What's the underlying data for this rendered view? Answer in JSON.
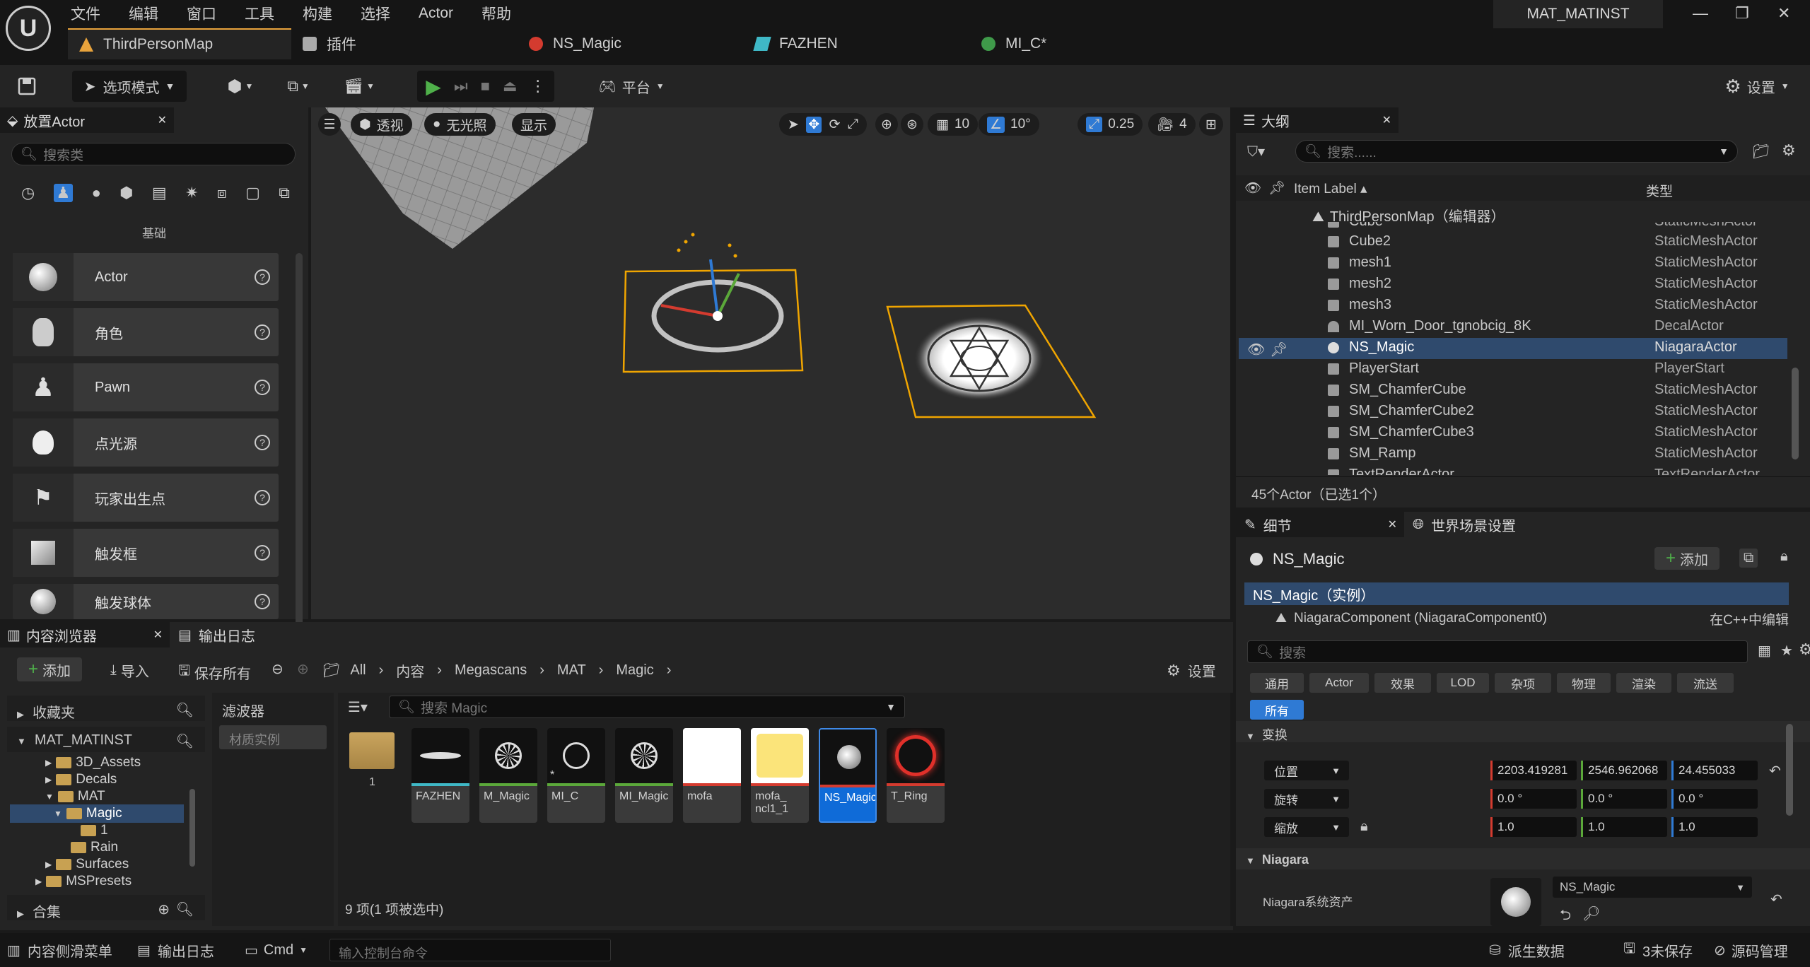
{
  "menu": [
    "文件",
    "编辑",
    "窗口",
    "工具",
    "构建",
    "选择",
    "Actor",
    "帮助"
  ],
  "project_name": "MAT_MATINST",
  "tabs": [
    {
      "label": "ThirdPersonMap",
      "color": "#e8a33c"
    },
    {
      "label": "插件",
      "color": "#bbbbbb"
    },
    {
      "label": "NS_Magic",
      "color": "#d43b2f"
    },
    {
      "label": "FAZHEN",
      "color": "#3fb8c6"
    },
    {
      "label": "MI_C*",
      "color": "#3f9a4a"
    }
  ],
  "toolbar": {
    "mode": "选项模式",
    "platform": "平台",
    "settings": "设置"
  },
  "place_actor": {
    "title": "放置Actor",
    "search_placeholder": "搜索类",
    "category": "基础",
    "items": [
      "Actor",
      "角色",
      "Pawn",
      "点光源",
      "玩家出生点",
      "触发框",
      "触发球体"
    ]
  },
  "viewport": {
    "perspective": "透视",
    "lighting": "无光照",
    "show": "显示",
    "grid": "10",
    "angle": "10°",
    "scale": "0.25",
    "camera": "4"
  },
  "outliner": {
    "title": "大纲",
    "search_placeholder": "搜索......",
    "col_label": "Item Label",
    "col_type": "类型",
    "map": "ThirdPersonMap（编辑器）",
    "rows": [
      {
        "name": "Cube",
        "type": "StaticMeshActor"
      },
      {
        "name": "Cube2",
        "type": "StaticMeshActor"
      },
      {
        "name": "mesh1",
        "type": "StaticMeshActor"
      },
      {
        "name": "mesh2",
        "type": "StaticMeshActor"
      },
      {
        "name": "mesh3",
        "type": "StaticMeshActor"
      },
      {
        "name": "MI_Worn_Door_tgnobcig_8K",
        "type": "DecalActor"
      },
      {
        "name": "NS_Magic",
        "type": "NiagaraActor"
      },
      {
        "name": "PlayerStart",
        "type": "PlayerStart"
      },
      {
        "name": "SM_ChamferCube",
        "type": "StaticMeshActor"
      },
      {
        "name": "SM_ChamferCube2",
        "type": "StaticMeshActor"
      },
      {
        "name": "SM_ChamferCube3",
        "type": "StaticMeshActor"
      },
      {
        "name": "SM_Ramp",
        "type": "StaticMeshActor"
      },
      {
        "name": "TextRenderActor",
        "type": "TextRenderActor"
      }
    ],
    "footer": "45个Actor（已选1个）"
  },
  "details": {
    "title": "细节",
    "world_settings": "世界场景设置",
    "object": "NS_Magic",
    "add": "添加",
    "instance": "NS_Magic（实例）",
    "component": "NiagaraComponent (NiagaraComponent0)",
    "edit_cpp": "在C++中编辑",
    "search_placeholder": "搜索",
    "categories": [
      "通用",
      "Actor",
      "效果",
      "LOD",
      "杂项",
      "物理",
      "渲染",
      "流送"
    ],
    "all": "所有",
    "transform": "变换",
    "location_label": "位置",
    "rotation_label": "旋转",
    "scale_label": "缩放",
    "location": [
      "2203.419281",
      "2546.962068",
      "24.455033"
    ],
    "rotation": [
      "0.0 °",
      "0.0 °",
      "0.0 °"
    ],
    "scale": [
      "1.0",
      "1.0",
      "1.0"
    ],
    "niagara": "Niagara",
    "niagara_asset_label": "Niagara系统资产",
    "niagara_asset": "NS_Magic"
  },
  "content_browser": {
    "title": "内容浏览器",
    "output_log": "输出日志",
    "add": "添加",
    "import": "导入",
    "save_all": "保存所有",
    "breadcrumb": [
      "All",
      "内容",
      "Megascans",
      "MAT",
      "Magic"
    ],
    "settings": "设置",
    "favorites": "收藏夹",
    "root": "MAT_MATINST",
    "tree": [
      "3D_Assets",
      "Decals",
      "MAT",
      "Magic",
      "1",
      "Rain",
      "Surfaces",
      "MSPresets"
    ],
    "collections": "合集",
    "filters": "滤波器",
    "filter_item": "材质实例",
    "search_placeholder": "搜索 Magic",
    "folder_label": "1",
    "assets": [
      {
        "name": "FAZHEN",
        "bar": "#3fb8c6"
      },
      {
        "name": "M_Magic",
        "bar": "#5ba83a"
      },
      {
        "name": "MI_C",
        "bar": "#5ba83a"
      },
      {
        "name": "MI_Magic",
        "bar": "#5ba83a"
      },
      {
        "name": "mofa",
        "bar": "#d43b2f"
      },
      {
        "name": "mofa_\nncl1_1",
        "bar": "#d43b2f"
      },
      {
        "name": "NS_Magic",
        "bar": "#d43b2f"
      },
      {
        "name": "T_Ring",
        "bar": "#d43b2f"
      }
    ],
    "count": "9 项(1 项被选中)"
  },
  "statusbar": {
    "drawer": "内容侧滑菜单",
    "output": "输出日志",
    "cmd": "Cmd",
    "console_placeholder": "输入控制台命令",
    "derived": "派生数据",
    "unsaved": "3未保存",
    "source": "源码管理"
  }
}
